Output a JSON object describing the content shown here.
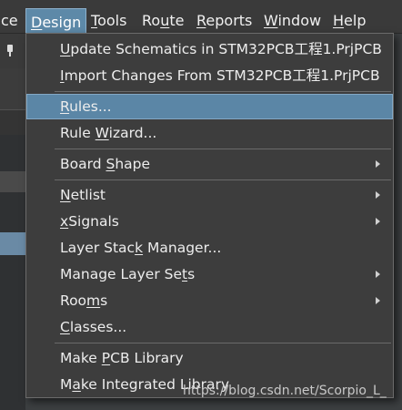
{
  "menubar": {
    "items": [
      {
        "label": "ce"
      },
      {
        "label": "Design",
        "underline": "D",
        "active": true
      },
      {
        "label": "Tools",
        "underline": "T"
      },
      {
        "label": "Route",
        "underline": "u"
      },
      {
        "label": "Reports",
        "underline": "R"
      },
      {
        "label": "Window",
        "underline": "W"
      },
      {
        "label": "Help",
        "underline": "H"
      }
    ]
  },
  "menu": {
    "items": [
      {
        "label": "Update Schematics in STM32PCB工程1.PrjPCB",
        "underline": "U"
      },
      {
        "label": "Import Changes From STM32PCB工程1.PrjPCB",
        "underline": "I"
      },
      {
        "label": "Rules...",
        "underline": "R",
        "selected": true
      },
      {
        "label": "Rule Wizard...",
        "underline": "W"
      },
      {
        "label": "Board Shape",
        "underline": "S",
        "submenu": true
      },
      {
        "label": "Netlist",
        "underline": "N",
        "submenu": true
      },
      {
        "label": "xSignals",
        "underline": "x",
        "submenu": true
      },
      {
        "label": "Layer Stack Manager...",
        "underline": "k"
      },
      {
        "label": "Manage Layer Sets",
        "underline": "t",
        "submenu": true
      },
      {
        "label": "Rooms",
        "underline": "m",
        "submenu": true
      },
      {
        "label": "Classes...",
        "underline": "C"
      },
      {
        "label": "Make PCB Library",
        "underline": "P"
      },
      {
        "label": "Make Integrated Library",
        "underline": "a"
      }
    ]
  },
  "watermark": "https://blog.csdn.net/Scorpio_L_",
  "colors": {
    "menubar_bg": "#3a3a3a",
    "menu_bg": "#3d3d3d",
    "highlight": "#5b86a6",
    "text": "#ededed"
  }
}
